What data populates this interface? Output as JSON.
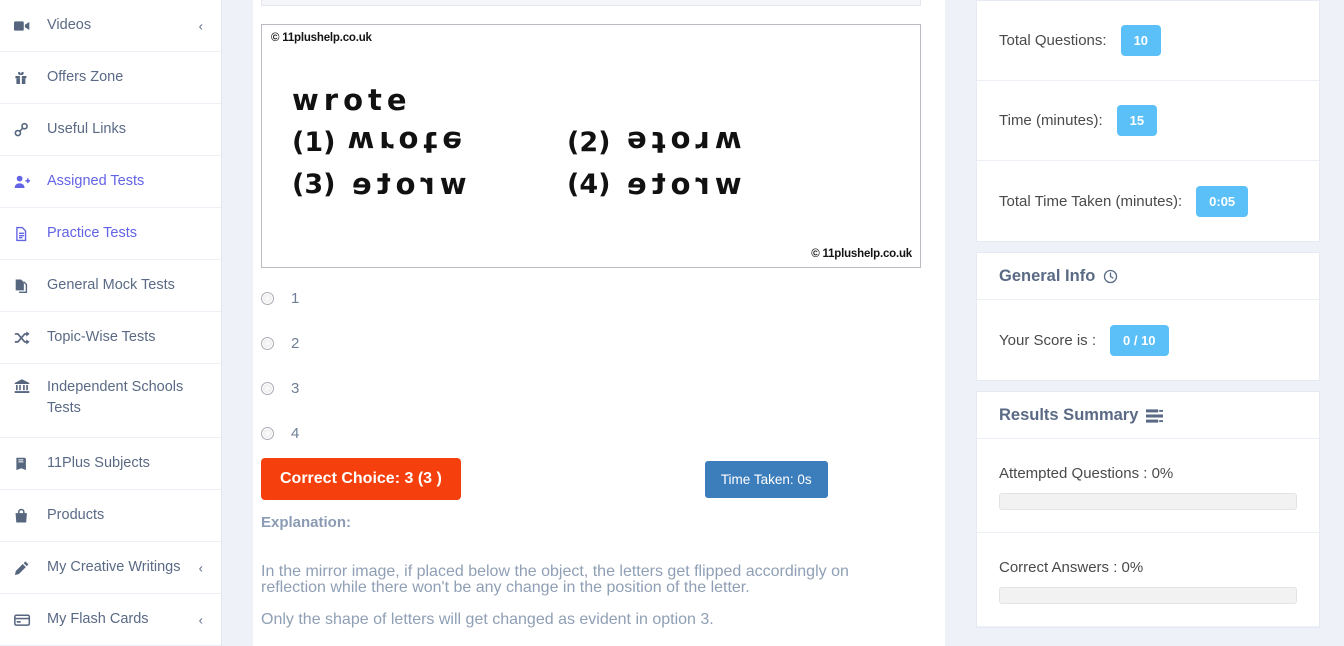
{
  "sidebar": {
    "items": [
      {
        "label": "Videos",
        "icon": "video-camera-icon",
        "active": false,
        "chevron": "‹",
        "slug": "videos"
      },
      {
        "label": "Offers Zone",
        "icon": "gift-icon",
        "active": false,
        "chevron": "",
        "slug": "offers-zone"
      },
      {
        "label": "Useful Links",
        "icon": "link-icon",
        "active": false,
        "chevron": "",
        "slug": "useful-links"
      },
      {
        "label": "Assigned Tests",
        "icon": "user-plus-icon",
        "active": true,
        "chevron": "",
        "slug": "assigned-tests"
      },
      {
        "label": "Practice Tests",
        "icon": "document-icon",
        "active": true,
        "chevron": "",
        "slug": "practice-tests"
      },
      {
        "label": "General Mock Tests",
        "icon": "copy-icon",
        "active": false,
        "chevron": "",
        "slug": "general-mock-tests"
      },
      {
        "label": "Topic-Wise Tests",
        "icon": "shuffle-icon",
        "active": false,
        "chevron": "",
        "slug": "topic-wise-tests"
      },
      {
        "label": "Independent Schools Tests",
        "icon": "bank-icon",
        "active": false,
        "chevron": "",
        "slug": "independent-schools-tests"
      },
      {
        "label": "11Plus Subjects",
        "icon": "book-icon",
        "active": false,
        "chevron": "",
        "slug": "11plus-subjects"
      },
      {
        "label": "Products",
        "icon": "shopping-bag-icon",
        "active": false,
        "chevron": "",
        "slug": "products"
      },
      {
        "label": "My Creative Writings",
        "icon": "pencil-icon",
        "active": false,
        "chevron": "‹",
        "slug": "my-creative-writings"
      },
      {
        "label": "My Flash Cards",
        "icon": "card-icon",
        "active": false,
        "chevron": "‹",
        "slug": "my-flash-cards"
      }
    ]
  },
  "question": {
    "watermark_top": "© 11plushelp.co.uk",
    "watermark_bottom": "© 11plushelp.co.uk",
    "prompt_word": "wrote",
    "choices_in_image": [
      {
        "number": "(1)",
        "word": "wrote",
        "transform": "flip-v"
      },
      {
        "number": "(2)",
        "word": "wrote",
        "transform": "flip-vh"
      },
      {
        "number": "(3)",
        "word": "wrote",
        "transform": "flip-v-shape"
      },
      {
        "number": "(4)",
        "word": "wrote",
        "transform": "flip-vh-shape"
      }
    ],
    "options": [
      "1",
      "2",
      "3",
      "4"
    ],
    "correct_choice_label": "Correct Choice: 3 (3 )",
    "time_taken_label": "Time Taken: 0s",
    "explanation_heading": "Explanation:",
    "explanation_paragraph_1": "In the mirror image, if placed below the object, the letters get flipped accordingly on reflection while there won't be any change in the position of the letter.",
    "explanation_paragraph_2": "Only the shape of letters will get changed as evident in option 3."
  },
  "stats": {
    "rows": [
      {
        "label": "Total Questions:",
        "value": "10"
      },
      {
        "label": "Time (minutes):",
        "value": "15"
      },
      {
        "label": "Total Time Taken (minutes):",
        "value": "0:05"
      }
    ]
  },
  "general_info": {
    "title": "General Info",
    "icon": "clock-icon",
    "score_label": "Your Score is :",
    "score_value": "0 / 10"
  },
  "results_summary": {
    "title": "Results Summary",
    "icon": "list-icon",
    "bars": [
      {
        "label": "Attempted Questions : 0%",
        "percent": 0
      },
      {
        "label": "Correct Answers : 0%",
        "percent": 0
      }
    ]
  },
  "colors": {
    "accent_blue": "#5bc0f8",
    "active_nav": "#6363e6",
    "correct_red": "#f5400d",
    "time_blue": "#3c7ebc",
    "page_bg": "#eef1f8"
  }
}
